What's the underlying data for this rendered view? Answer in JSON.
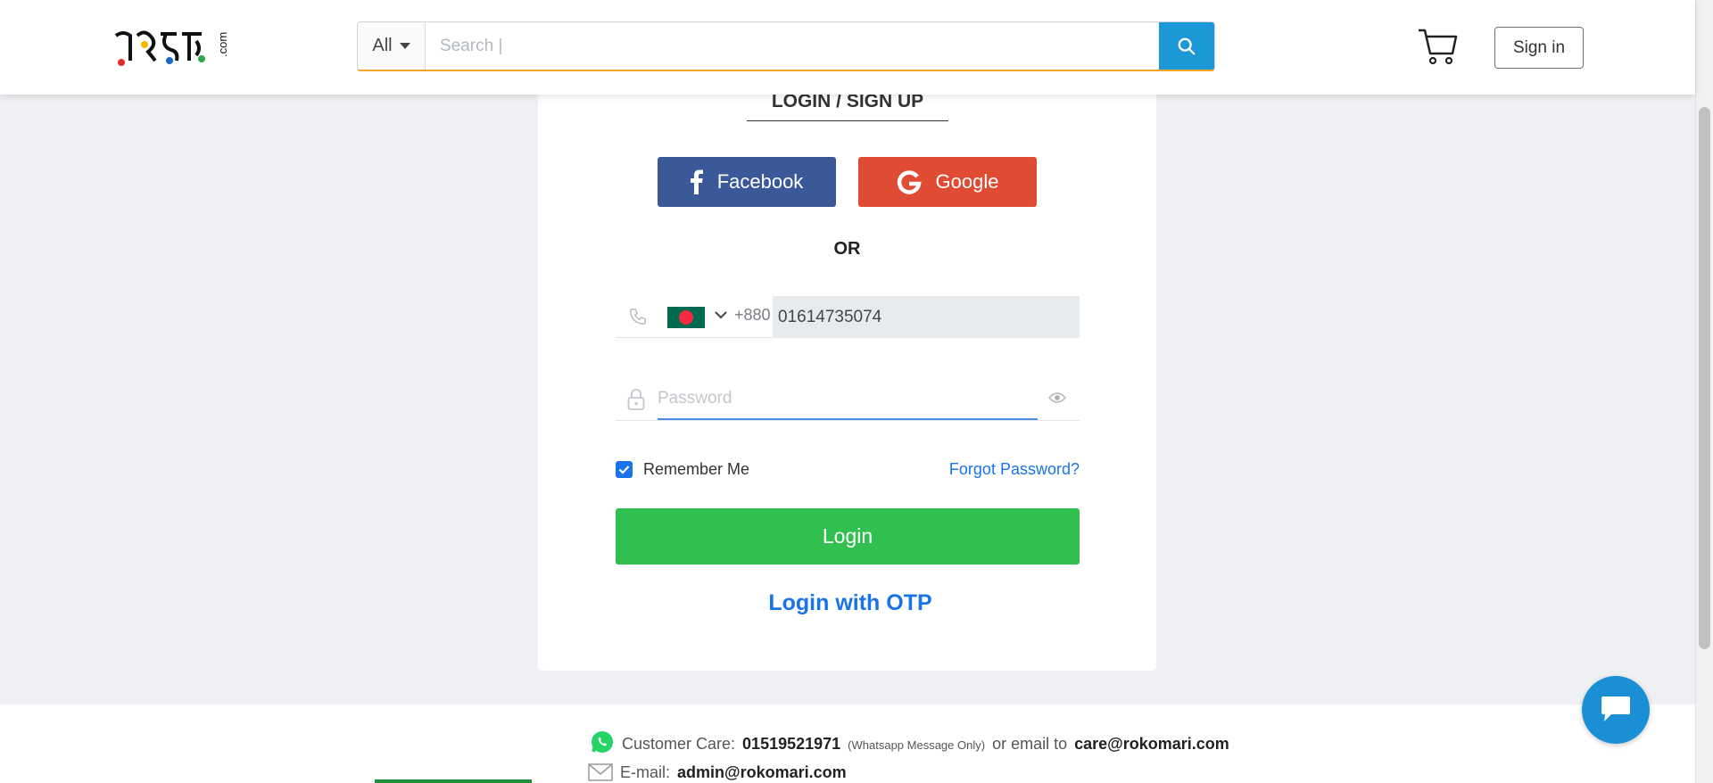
{
  "header": {
    "logo_text": "রকমারি.com",
    "search": {
      "category": "All",
      "placeholder": "Search |"
    },
    "signin_label": "Sign in"
  },
  "login": {
    "title": "LOGIN / SIGN UP",
    "facebook_label": "Facebook",
    "google_label": "Google",
    "or_label": "OR",
    "dial_code": "+880",
    "phone_value": "01614735074",
    "password_placeholder": "Password",
    "remember_label": "Remember Me",
    "remember_checked": true,
    "forgot_label": "Forgot Password?",
    "login_label": "Login",
    "otp_label": "Login with OTP"
  },
  "footer": {
    "care_label": "Customer  Care:",
    "care_phone": "01519521971",
    "care_note": "(Whatsapp Message Only)",
    "or_email_label": "or  email  to",
    "care_email": "care@rokomari.com",
    "email_label": "E-mail:",
    "admin_email": "admin@rokomari.com"
  },
  "colors": {
    "search_button": "#1d98d6",
    "facebook": "#3b5998",
    "google": "#e04b33",
    "login_button": "#31c04f",
    "link": "#1a73e8",
    "chat_bubble": "#1a8fd6"
  },
  "icons": [
    "search-icon",
    "cart-icon",
    "facebook-icon",
    "google-icon",
    "phone-icon",
    "bangladesh-flag-icon",
    "chevron-down-icon",
    "lock-icon",
    "eye-icon",
    "check-icon",
    "whatsapp-icon",
    "mail-icon",
    "chat-icon"
  ]
}
